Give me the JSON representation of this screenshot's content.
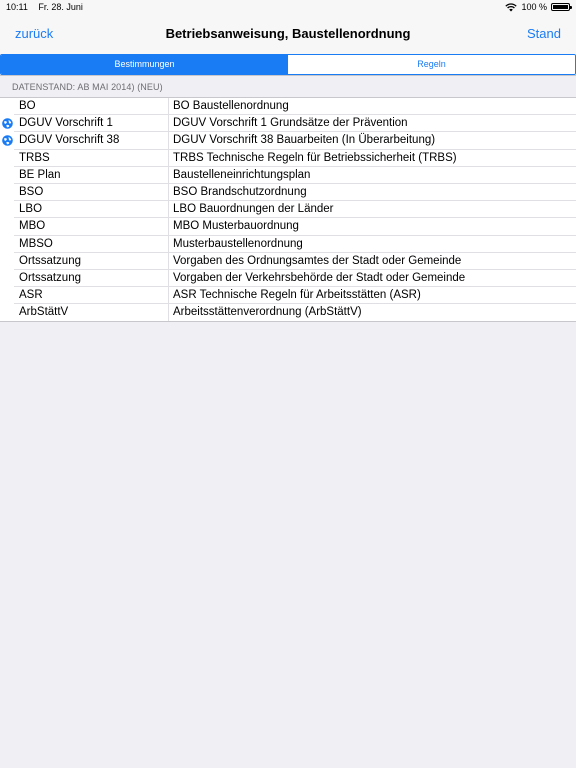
{
  "status": {
    "time": "10:11",
    "date": "Fr. 28. Juni",
    "battery": "100 %",
    "battery_level": 1.0
  },
  "nav": {
    "back": "zurück",
    "title": "Betriebsanweisung, Baustellenordnung",
    "action": "Stand"
  },
  "segments": {
    "items": [
      "Bestimmungen",
      "Regeln"
    ],
    "selected": "Bestimmungen"
  },
  "section_header": "DATENSTAND: AB MAI 2014) (NEU)",
  "accent_color": "#1a7cf5",
  "rows": [
    {
      "code": "BO",
      "desc": "BO Baustellenordnung",
      "icon": ""
    },
    {
      "code": "DGUV Vorschrift 1",
      "desc": "DGUV Vorschrift 1 Grundsätze der Prävention",
      "icon": "globe-icon"
    },
    {
      "code": "DGUV Vorschrift 38",
      "desc": "DGUV Vorschrift 38 Bauarbeiten (In Überarbeitung)",
      "icon": "globe-icon"
    },
    {
      "code": "TRBS",
      "desc": "TRBS Technische Regeln für Betriebssicherheit (TRBS)",
      "icon": ""
    },
    {
      "code": "BE Plan",
      "desc": "Baustelleneinrichtungsplan",
      "icon": ""
    },
    {
      "code": "BSO",
      "desc": "BSO Brandschutzordnung",
      "icon": ""
    },
    {
      "code": "LBO",
      "desc": "LBO Bauordnungen der Länder",
      "icon": ""
    },
    {
      "code": "MBO",
      "desc": "MBO Musterbauordnung",
      "icon": ""
    },
    {
      "code": "MBSO",
      "desc": "Musterbaustellenordnung",
      "icon": ""
    },
    {
      "code": "Ortssatzung",
      "desc": "Vorgaben des Ordnungsamtes der Stadt oder Gemeinde",
      "icon": ""
    },
    {
      "code": "Ortssatzung",
      "desc": "Vorgaben der Verkehrsbehörde der Stadt oder Gemeinde",
      "icon": ""
    },
    {
      "code": "ASR",
      "desc": "ASR Technische Regeln für Arbeitsstätten (ASR)",
      "icon": ""
    },
    {
      "code": "ArbStättV",
      "desc": "Arbeitsstättenverordnung (ArbStättV)",
      "icon": ""
    }
  ]
}
